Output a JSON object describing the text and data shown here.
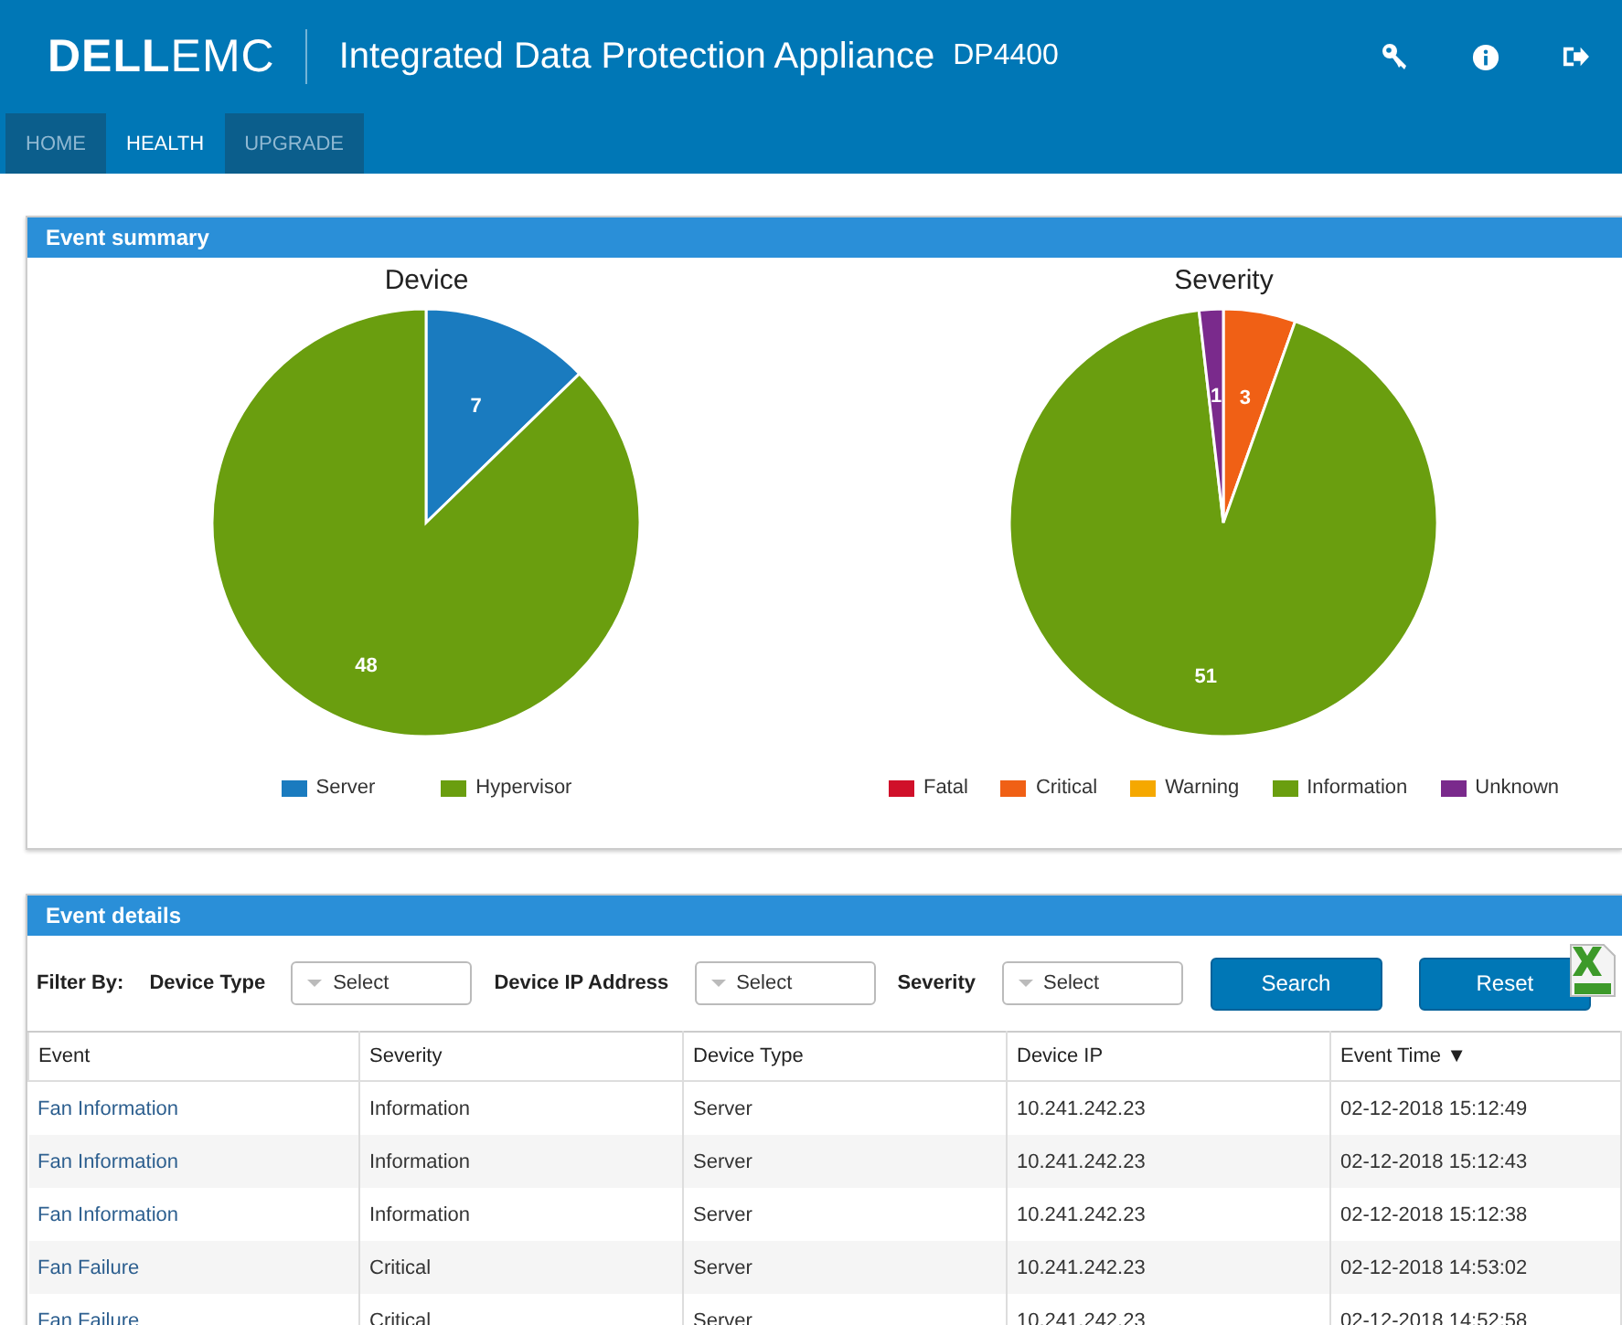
{
  "header": {
    "brand_bold": "DELL",
    "brand_light": "EMC",
    "title": "Integrated Data Protection Appliance",
    "model": "DP4400"
  },
  "tabs": [
    {
      "label": "HOME",
      "selected": false
    },
    {
      "label": "HEALTH",
      "selected": true
    },
    {
      "label": "UPGRADE",
      "selected": false
    }
  ],
  "event_summary": {
    "title": "Event summary",
    "charts": [
      {
        "chart_data": {
          "type": "pie",
          "title": "Device",
          "categories": [
            "Server",
            "Hypervisor"
          ],
          "values": [
            7,
            48
          ],
          "legend": "bottom",
          "colors": [
            "#1a7bbf",
            "#6a9e0f"
          ],
          "data_labels": true
        }
      },
      {
        "chart_data": {
          "type": "pie",
          "title": "Severity",
          "categories": [
            "Fatal",
            "Critical",
            "Warning",
            "Information",
            "Unknown"
          ],
          "values": [
            0,
            3,
            0,
            51,
            1
          ],
          "legend": "bottom",
          "colors": [
            "#d0102a",
            "#f06015",
            "#f5a800",
            "#6a9e0f",
            "#7a2a8c"
          ],
          "data_labels": true
        }
      }
    ]
  },
  "event_details": {
    "title": "Event details",
    "filter_label": "Filter By:",
    "filters": [
      {
        "label": "Device Type",
        "placeholder": "Select"
      },
      {
        "label": "Device IP Address",
        "placeholder": "Select"
      },
      {
        "label": "Severity",
        "placeholder": "Select"
      }
    ],
    "buttons": [
      "Search",
      "Reset"
    ],
    "table": {
      "columns": [
        "Event",
        "Severity",
        "Device Type",
        "Device IP",
        "Event Time ▼"
      ],
      "rows": [
        [
          "Fan Information",
          "Information",
          "Server",
          "10.241.242.23",
          "02-12-2018 15:12:49"
        ],
        [
          "Fan Information",
          "Information",
          "Server",
          "10.241.242.23",
          "02-12-2018 15:12:43"
        ],
        [
          "Fan Information",
          "Information",
          "Server",
          "10.241.242.23",
          "02-12-2018 15:12:38"
        ],
        [
          "Fan Failure",
          "Critical",
          "Server",
          "10.241.242.23",
          "02-12-2018 14:53:02"
        ],
        [
          "Fan Failure",
          "Critical",
          "Server",
          "10.241.242.23",
          "02-12-2018 14:52:58"
        ]
      ]
    }
  }
}
